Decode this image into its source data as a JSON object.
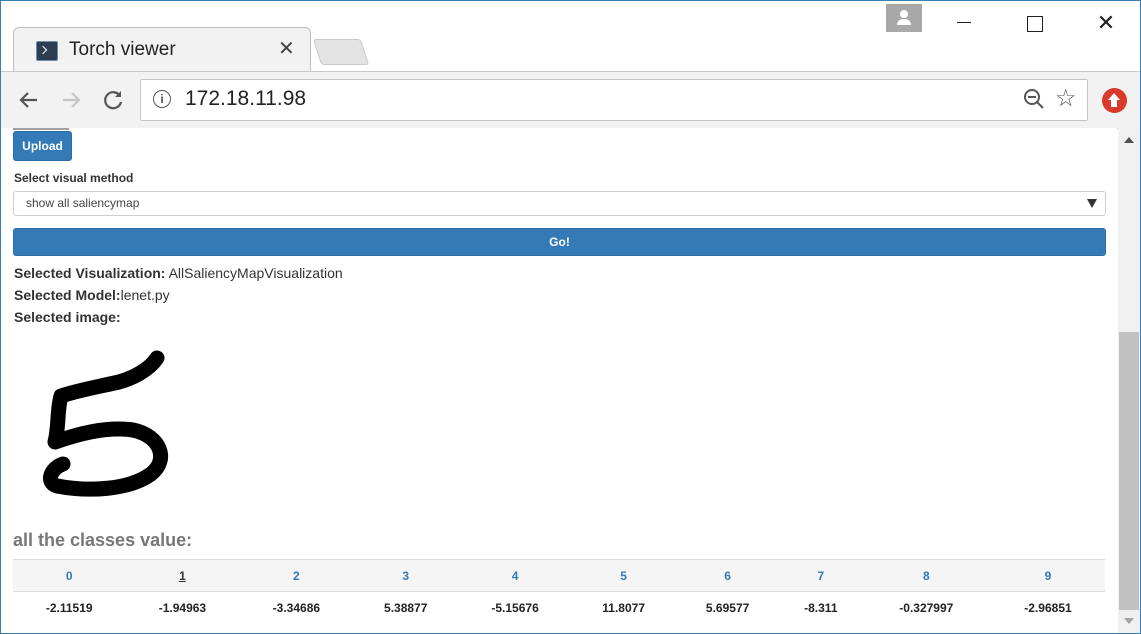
{
  "browser": {
    "tab_title": "Torch viewer",
    "tab_close": "✕",
    "url": "172.18.11.98",
    "window_controls": {
      "close": "✕"
    }
  },
  "form": {
    "upload_label": "Upload",
    "method_label": "Select visual method",
    "method_selected": "show all saliencymap",
    "go_label": "Go!"
  },
  "selection": {
    "visualization_label": "Selected Visualization:",
    "visualization_value": " AllSaliencyMapVisualization",
    "model_label": "Selected Model:",
    "model_value": "lenet.py",
    "image_label": "Selected image:"
  },
  "classes": {
    "heading": "all the classes value:",
    "headers": [
      "0",
      "1",
      "2",
      "3",
      "4",
      "5",
      "6",
      "7",
      "8",
      "9"
    ],
    "values": [
      "-2.11519",
      "-1.94963",
      "-3.34686",
      "5.38877",
      "-5.15676",
      "11.8077",
      "5.69577",
      "-8.311",
      "-0.327997",
      "-2.96851"
    ],
    "sorted_column": "1"
  },
  "colors": {
    "primary_button": "#337ab7",
    "heading_gray": "#777777",
    "window_border": "#3c7fb1",
    "extension_red": "#d93a2c"
  },
  "icons": [
    "terminal-tab-icon",
    "close-icon",
    "profile-icon",
    "minimize-icon",
    "maximize-icon",
    "back-arrow-icon",
    "forward-arrow-icon",
    "reload-icon",
    "info-icon",
    "zoom-out-icon",
    "star-icon",
    "upload-extension-icon",
    "dropdown-arrow-icon"
  ]
}
